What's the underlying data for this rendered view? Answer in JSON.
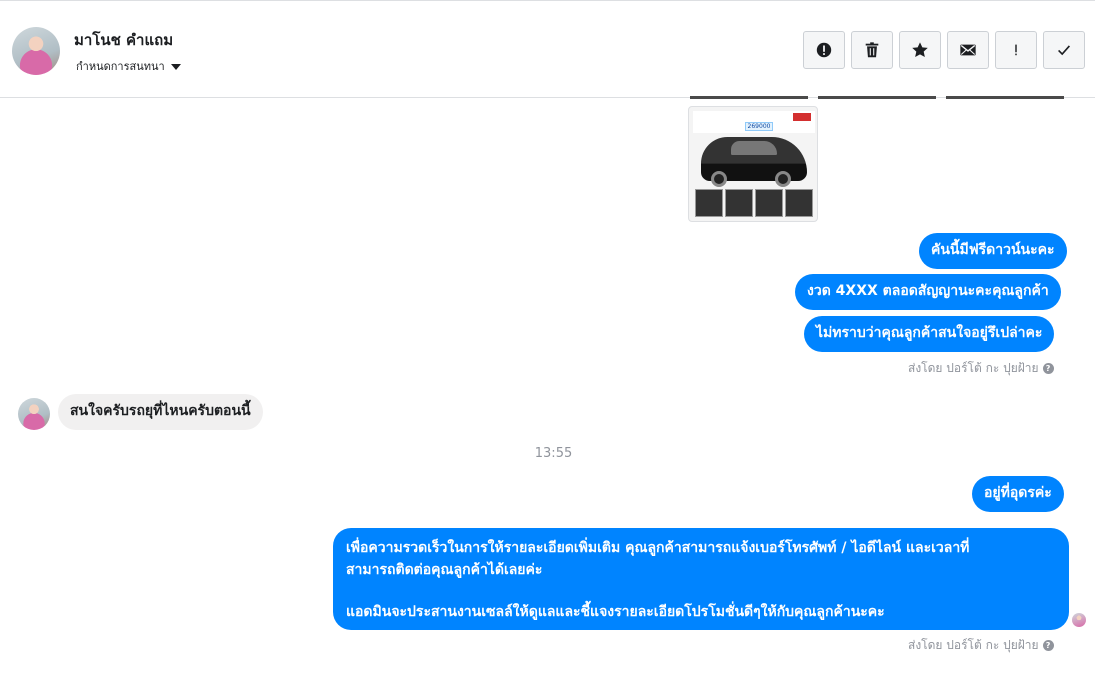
{
  "header": {
    "contact_name": "มาโนช คำแถม",
    "conversation_settings": "กำหนดการสนทนา",
    "toolbar": [
      {
        "name": "report-spam-button",
        "icon": "exclamation-circle-icon"
      },
      {
        "name": "delete-button",
        "icon": "trash-icon"
      },
      {
        "name": "star-button",
        "icon": "star-icon"
      },
      {
        "name": "mark-unread-button",
        "icon": "envelope-icon"
      },
      {
        "name": "follow-up-button",
        "icon": "exclamation-icon"
      },
      {
        "name": "mark-done-button",
        "icon": "check-icon"
      }
    ]
  },
  "thread": {
    "car_ad": {
      "price": "269000"
    },
    "messages": {
      "out1": "คันนี้มีฟรีดาวน์นะคะ",
      "out2": "งวด 4XXX ตลอดสัญญานะคะคุณลูกค้า",
      "out3": "ไม่ทราบว่าคุณลูกค้าสนใจอยู่รึเปล่าคะ",
      "sent_by_1": "ส่งโดย ปอร์โต้ กะ ปุยฝ้าย",
      "in1": "สนใจครับรถยุที่ไหนครับตอนนี้",
      "timestamp": "13:55",
      "out4": "อยู่ที่อุดรค่ะ",
      "out5_line1": "เพื่อความรวดเร็วในการให้รายละเอียดเพิ่มเติม คุณลูกค้าสามารถแจ้งเบอร์โทรศัพท์ / ไอดีไลน์ และเวลาที่",
      "out5_line2": "สามารถติดต่อคุณลูกค้าได้เลยค่ะ",
      "out5_line3": "แอดมินจะประสานงานเซลล์ให้ดูแลและชี้แจงรายละเอียดโปรโมชั่นดีๆให้กับคุณลูกค้านะคะ",
      "sent_by_2": "ส่งโดย ปอร์โต้ กะ ปุยฝ้าย"
    }
  },
  "colors": {
    "bubble_blue": "#0084ff",
    "bubble_gray": "#f1f0f0",
    "meta_gray": "#90949c"
  }
}
